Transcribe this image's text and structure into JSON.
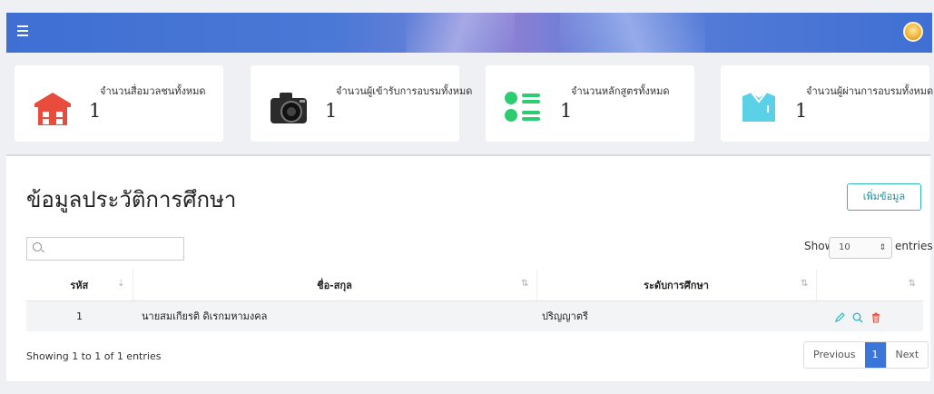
{
  "header": {
    "menu_icon": "hamburger-icon",
    "avatar_icon": "user-avatar-icon"
  },
  "stats": [
    {
      "label": "จำนวนสื่อมวลชนทั้งหมด",
      "value": "1",
      "icon": "warehouse-icon",
      "color": "#e74c3c"
    },
    {
      "label": "จำนวนผู้เข้ารับการอบรมทั้งหมด",
      "value": "1",
      "icon": "camera-icon",
      "color": "#333333"
    },
    {
      "label": "จำนวนหลักสูตรทั้งหมด",
      "value": "1",
      "icon": "list-icon",
      "color": "#2ecc71"
    },
    {
      "label": "จำนวนผู้ผ่านการอบรมทั้งหมด",
      "value": "1",
      "icon": "shirt-icon",
      "color": "#5ad1e6"
    }
  ],
  "panel": {
    "title": "ข้อมูลประวัติการศึกษา",
    "add_label": "เพิ่มข้อมูล",
    "search_value": "",
    "show_label": "Show",
    "page_length": "10",
    "entries_label": "entries"
  },
  "table": {
    "columns": [
      "รหัส",
      "ชื่อ-สกุล",
      "ระดับการศึกษา",
      ""
    ],
    "rows": [
      {
        "id": "1",
        "name": "นายสมเกียรติ ดิเรกมหามงคล",
        "level": "ปริญญาตรี"
      }
    ]
  },
  "footer": {
    "info": "Showing 1 to 1 of 1 entries",
    "prev": "Previous",
    "page": "1",
    "next": "Next"
  },
  "colors": {
    "header": "#3f6fd3",
    "accent": "#2fb6c0",
    "danger": "#e74c3c",
    "pager_active": "#3a76d9"
  }
}
